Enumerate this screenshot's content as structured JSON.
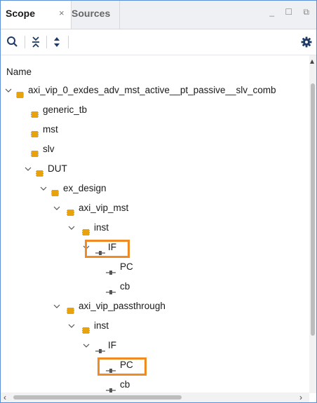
{
  "tabs": {
    "scope": {
      "label": "Scope",
      "close": "×"
    },
    "sources": {
      "label": "Sources"
    }
  },
  "window_controls": "_ ☐ ⧉",
  "header": {
    "column_name": "Name"
  },
  "tree": [
    {
      "label": "axi_vip_0_exdes_adv_mst_active__pt_passive__slv_comb",
      "kind": "module",
      "expandable": true
    },
    {
      "label": "generic_tb",
      "kind": "module",
      "expandable": false
    },
    {
      "label": "mst",
      "kind": "module",
      "expandable": false
    },
    {
      "label": "slv",
      "kind": "module",
      "expandable": false
    },
    {
      "label": "DUT",
      "kind": "module",
      "expandable": true
    },
    {
      "label": "ex_design",
      "kind": "module",
      "expandable": true
    },
    {
      "label": "axi_vip_mst",
      "kind": "module",
      "expandable": true
    },
    {
      "label": "inst",
      "kind": "module",
      "expandable": true
    },
    {
      "label": "IF",
      "kind": "interface",
      "expandable": true,
      "highlighted": true
    },
    {
      "label": "PC",
      "kind": "interface",
      "expandable": false
    },
    {
      "label": "cb",
      "kind": "interface",
      "expandable": false
    },
    {
      "label": "axi_vip_passthrough",
      "kind": "module",
      "expandable": true
    },
    {
      "label": "inst",
      "kind": "module",
      "expandable": true
    },
    {
      "label": "IF",
      "kind": "interface",
      "expandable": true
    },
    {
      "label": "PC",
      "kind": "interface",
      "expandable": false,
      "highlighted": true
    },
    {
      "label": "cb",
      "kind": "interface",
      "expandable": false
    }
  ],
  "colors": {
    "module_icon": "#e8a20c",
    "highlight": "#f08a24",
    "accent_border": "#5b8fd6"
  },
  "icons": [
    "search-icon",
    "collapse-all-icon",
    "expand-all-icon",
    "settings-gear-icon"
  ]
}
